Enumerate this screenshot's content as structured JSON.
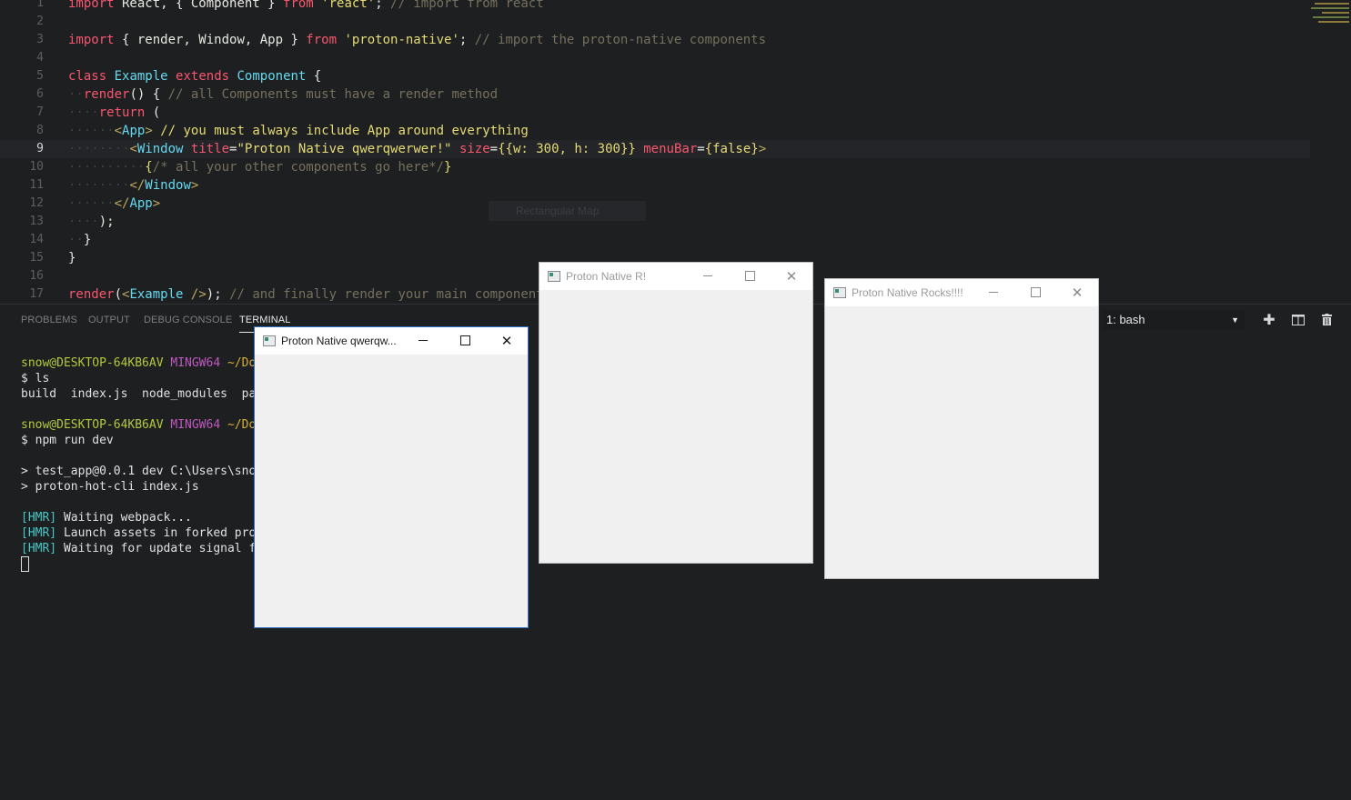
{
  "editor": {
    "line_numbers": [
      "1",
      "2",
      "3",
      "4",
      "5",
      "6",
      "7",
      "8",
      "9",
      "10",
      "11",
      "12",
      "13",
      "14",
      "15",
      "16",
      "17"
    ],
    "current_line": "9",
    "ghost_popup_text": "Rectangular Map"
  },
  "panel": {
    "tabs": [
      "PROBLEMS",
      "OUTPUT",
      "DEBUG CONSOLE",
      "TERMINAL"
    ],
    "active_tab": "TERMINAL",
    "terminal_selector": "1: bash"
  },
  "terminal": {
    "user_host": "snow@DESKTOP-64KB6AV",
    "shell": "MINGW64",
    "path_partial": "~/Docume",
    "cmd1": "$ ls",
    "ls_output": "build  index.js  node_modules  packag",
    "cmd2": "$ npm run dev",
    "npm_line1": "> test_app@0.0.1 dev C:\\Users\\snow\\Do",
    "npm_line2": "> proton-hot-cli index.js",
    "hmr_tag": "[HMR]",
    "hmr1": " Waiting webpack...",
    "hmr2": " Launch assets in forked process",
    "hmr3": " Waiting for update signal from"
  },
  "windows": [
    {
      "title": "Proton Native qwerqw...",
      "active": true
    },
    {
      "title": "Proton Native R!",
      "active": false
    },
    {
      "title": "Proton Native Rocks!!!!",
      "active": false
    }
  ],
  "icons": [
    "window-app-icon",
    "minimize-icon",
    "maximize-icon",
    "close-icon",
    "plus-icon",
    "split-icon",
    "trash-icon",
    "chevron-down-icon"
  ]
}
